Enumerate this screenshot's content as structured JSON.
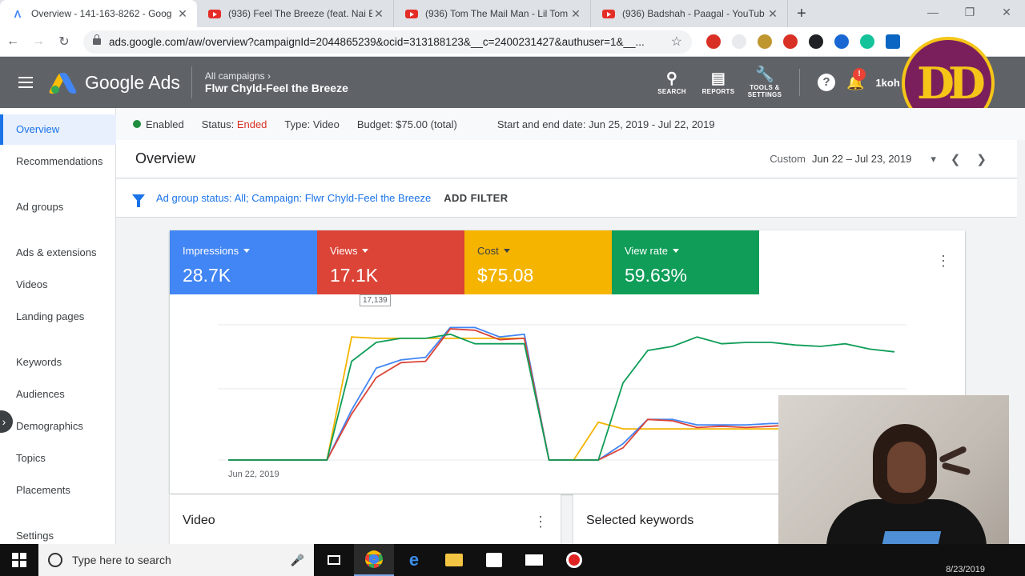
{
  "browser": {
    "tabs": [
      {
        "title": "Overview - 141-163-8262 - Goog",
        "type": "ads",
        "active": true
      },
      {
        "title": "(936) Feel The Breeze (feat. Nai B",
        "type": "youtube",
        "active": false
      },
      {
        "title": "(936) Tom The Mail Man - Lil Tom",
        "type": "youtube",
        "active": false
      },
      {
        "title": "(936) Badshah - Paagal - YouTub",
        "type": "youtube",
        "active": false
      }
    ],
    "url": "ads.google.com/aw/overview?campaignId=2044865239&ocid=313188123&__c=2400231427&authuser=1&__..."
  },
  "header": {
    "brand": "Google Ads",
    "breadcrumb_parent": "All campaigns",
    "campaign_name": "Flwr Chyld-Feel the Breeze",
    "tools": [
      {
        "label": "SEARCH",
        "icon": "search-icon"
      },
      {
        "label": "REPORTS",
        "icon": "reports-icon"
      },
      {
        "label": "TOOLS &\nSETTINGS",
        "icon": "wrench-icon"
      }
    ],
    "notifications_badge": "!",
    "account": "1koh"
  },
  "overlay_logo": "DD",
  "sidebar": {
    "items": [
      {
        "label": "Overview",
        "active": true
      },
      {
        "label": "Recommendations"
      },
      {
        "label": "Ad groups"
      },
      {
        "label": "Ads & extensions"
      },
      {
        "label": "Videos"
      },
      {
        "label": "Landing pages"
      },
      {
        "label": "Keywords"
      },
      {
        "label": "Audiences"
      },
      {
        "label": "Demographics"
      },
      {
        "label": "Topics"
      },
      {
        "label": "Placements"
      },
      {
        "label": "Settings"
      }
    ]
  },
  "status": {
    "enabled": "Enabled",
    "status_label": "Status:",
    "status_value": "Ended",
    "type": "Type: Video",
    "budget": "Budget: $75.00 (total)",
    "dates": "Start and end date: Jun 25, 2019 - Jul 22, 2019"
  },
  "overview": {
    "title": "Overview",
    "range_label": "Custom",
    "range_value": "Jun 22 – Jul 23, 2019"
  },
  "filter": {
    "text": "Ad group status: All; Campaign: ",
    "campaign": "Flwr Chyld-Feel the Breeze",
    "add": "ADD FILTER"
  },
  "metrics": [
    {
      "label": "Impressions",
      "value": "28.7K",
      "color": "#4285f4"
    },
    {
      "label": "Views",
      "value": "17.1K",
      "color": "#db4437"
    },
    {
      "label": "Cost",
      "value": "$75.08",
      "color": "#f4b400"
    },
    {
      "label": "View rate",
      "value": "59.63%",
      "color": "#0f9d58"
    }
  ],
  "tooltip": "17,139",
  "chart_data": {
    "type": "line",
    "x_start_label": "Jun 22, 2019",
    "series": [
      {
        "name": "Impressions",
        "color": "#4285f4",
        "values": [
          0,
          0,
          0,
          0,
          0,
          0.37,
          0.68,
          0.74,
          0.76,
          0.98,
          0.98,
          0.91,
          0.93,
          0,
          0,
          0,
          0.12,
          0.3,
          0.3,
          0.26,
          0.26,
          0.26,
          0.27,
          0.27,
          0.27,
          0.26,
          0.28,
          0.3
        ]
      },
      {
        "name": "Views",
        "color": "#db4437",
        "values": [
          0,
          0,
          0,
          0,
          0,
          0.34,
          0.61,
          0.72,
          0.73,
          0.97,
          0.96,
          0.89,
          0.9,
          0,
          0,
          0,
          0.09,
          0.3,
          0.29,
          0.24,
          0.25,
          0.24,
          0.25,
          0.26,
          0.24,
          0.24,
          0.25,
          0.28
        ]
      },
      {
        "name": "Cost",
        "color": "#f4b400",
        "values": [
          0,
          0,
          0,
          0,
          0,
          0.91,
          0.9,
          0.9,
          0.9,
          0.9,
          0.9,
          0.9,
          0.9,
          0,
          0,
          0.28,
          0.23,
          0.23,
          0.23,
          0.23,
          0.23,
          0.23,
          0.23,
          0.23,
          0.23,
          0.23,
          0.23,
          0.23
        ]
      },
      {
        "name": "View rate",
        "color": "#0f9d58",
        "values": [
          0,
          0,
          0,
          0,
          0,
          0.73,
          0.87,
          0.9,
          0.9,
          0.93,
          0.86,
          0.86,
          0.86,
          0,
          0,
          0,
          0.57,
          0.81,
          0.84,
          0.91,
          0.86,
          0.87,
          0.87,
          0.85,
          0.84,
          0.86,
          0.82,
          0.8
        ]
      }
    ]
  },
  "subcards": {
    "video": "Video",
    "keywords": "Selected keywords"
  },
  "taskbar": {
    "search_placeholder": "Type here to search",
    "date": "8/23/2019"
  }
}
